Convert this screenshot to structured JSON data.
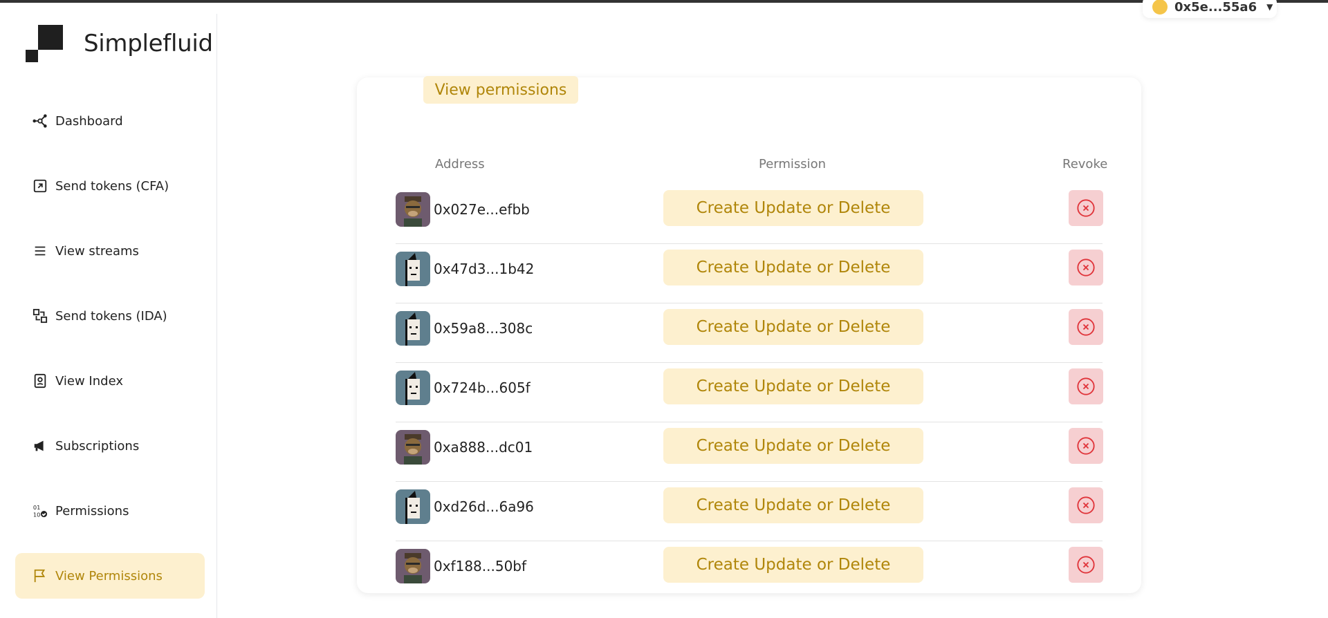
{
  "app": {
    "logo_text": "Simplefluid",
    "wallet_address": "0x5e...55a6"
  },
  "sidebar": {
    "items": [
      {
        "label": "Dashboard",
        "icon": "network-icon",
        "active": false
      },
      {
        "label": "Send tokens (CFA)",
        "icon": "arrow-up-right-square-icon",
        "active": false
      },
      {
        "label": "View streams",
        "icon": "list-lines-icon",
        "active": false
      },
      {
        "label": "Send tokens (IDA)",
        "icon": "transfer-squares-icon",
        "active": false
      },
      {
        "label": "View Index",
        "icon": "id-card-icon",
        "active": false
      },
      {
        "label": "Subscriptions",
        "icon": "megaphone-icon",
        "active": false
      },
      {
        "label": "Permissions",
        "icon": "binary-check-icon",
        "active": false
      },
      {
        "label": "View Permissions",
        "icon": "flag-icon",
        "active": true
      }
    ]
  },
  "main": {
    "title": "View permissions",
    "columns": {
      "address": "Address",
      "permission": "Permission",
      "revoke": "Revoke"
    },
    "rows": [
      {
        "avatar": "ape",
        "address": "0x027e...efbb",
        "permission": "Create Update or Delete"
      },
      {
        "avatar": "punk",
        "address": "0x47d3...1b42",
        "permission": "Create Update or Delete"
      },
      {
        "avatar": "punk",
        "address": "0x59a8...308c",
        "permission": "Create Update or Delete"
      },
      {
        "avatar": "punk",
        "address": "0x724b...605f",
        "permission": "Create Update or Delete"
      },
      {
        "avatar": "ape",
        "address": "0xa888...dc01",
        "permission": "Create Update or Delete"
      },
      {
        "avatar": "punk",
        "address": "0xd26d...6a96",
        "permission": "Create Update or Delete"
      },
      {
        "avatar": "ape",
        "address": "0xf188...50bf",
        "permission": "Create Update or Delete"
      }
    ]
  },
  "colors": {
    "accent_bg": "#fdf0cf",
    "accent_text": "#b0860a",
    "revoke_bg": "#f6cfd1",
    "revoke_icon": "#e0343a"
  }
}
